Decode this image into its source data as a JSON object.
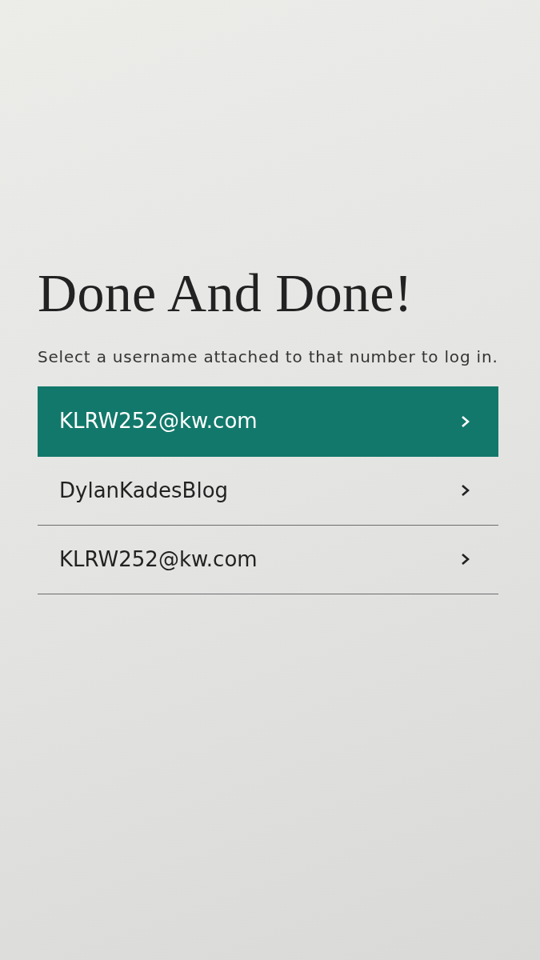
{
  "heading": "Done And Done!",
  "instruction": "Select a username attached to that number to log in.",
  "accounts": [
    {
      "label": "KLRW252@kw.com",
      "selected": true
    },
    {
      "label": "DylanKadesBlog",
      "selected": false
    },
    {
      "label": "KLRW252@kw.com",
      "selected": false
    }
  ]
}
